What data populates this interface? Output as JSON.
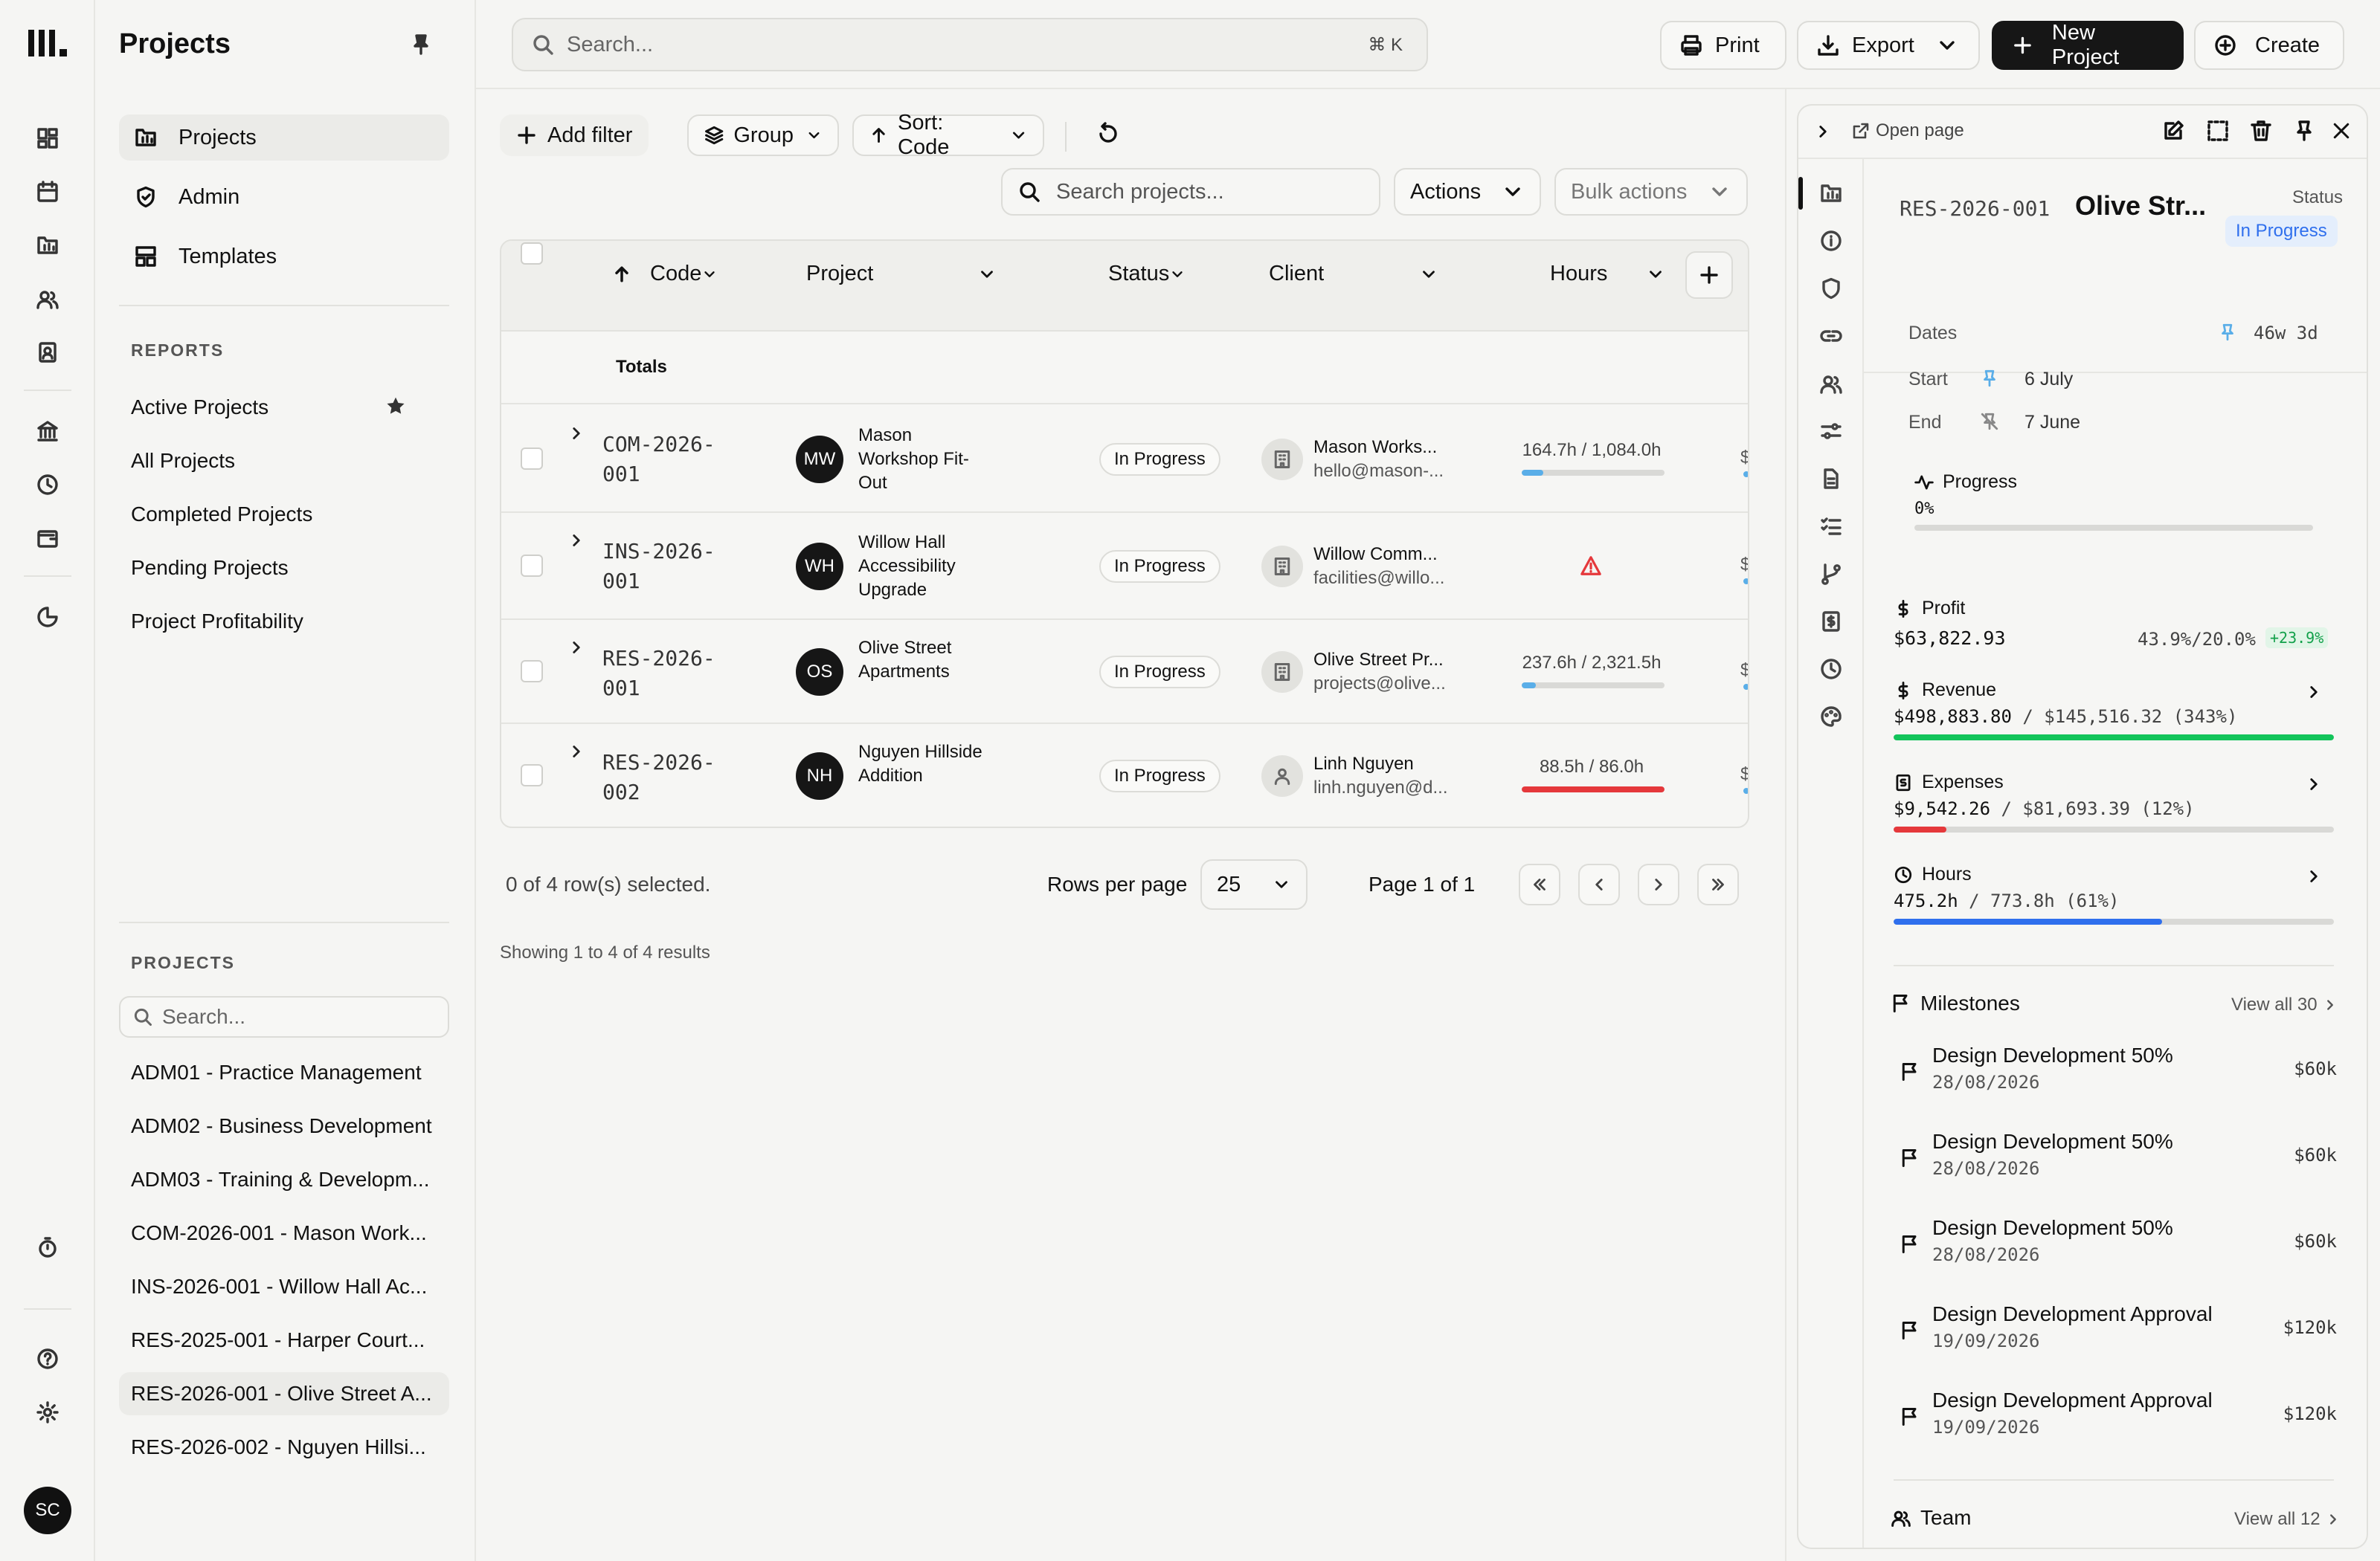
{
  "app": {
    "title": "Projects"
  },
  "sidebar": {
    "title": "Projects",
    "nav": [
      {
        "label": "Projects",
        "icon": "projects-icon"
      },
      {
        "label": "Admin",
        "icon": "shield-icon"
      },
      {
        "label": "Templates",
        "icon": "templates-icon"
      }
    ],
    "reports_label": "REPORTS",
    "reports": [
      "Active Projects",
      "All Projects",
      "Completed Projects",
      "Pending Projects",
      "Project Profitability"
    ],
    "projects_label": "PROJECTS",
    "search_placeholder": "Search...",
    "projects": [
      "ADM01 - Practice Management",
      "ADM02 - Business Development",
      "ADM03 - Training & Developm...",
      "COM-2026-001 - Mason Work...",
      "INS-2026-001 - Willow Hall Ac...",
      "RES-2025-001 - Harper Court...",
      "RES-2026-001 - Olive Street A...",
      "RES-2026-002 - Nguyen Hillsi..."
    ],
    "user_initials": "SC"
  },
  "topbar": {
    "search_placeholder": "Search...",
    "shortcut": "⌘ K",
    "print": "Print",
    "export": "Export",
    "new_project": "New Project",
    "create": "Create"
  },
  "toolbar": {
    "add_filter": "Add filter",
    "group": "Group",
    "sort": "Sort: Code",
    "search_placeholder": "Search projects...",
    "actions": "Actions",
    "bulk_actions": "Bulk actions"
  },
  "table": {
    "columns": [
      "Code",
      "Project",
      "Status",
      "Client",
      "Hours"
    ],
    "totals_label": "Totals",
    "rows": [
      {
        "code1": "COM-2026-",
        "code2": "001",
        "initials": "MW",
        "project": "Mason Workshop Fit-Out",
        "status": "In Progress",
        "client": "Mason Works...",
        "email": "hello@mason-...",
        "hours": "164.7h / 1,084.0h",
        "progress": 0.15,
        "bar_color": "#5aaee8",
        "client_type": "company"
      },
      {
        "code1": "INS-2026-",
        "code2": "001",
        "initials": "WH",
        "project": "Willow Hall Accessibility Upgrade",
        "status": "In Progress",
        "client": "Willow Comm...",
        "email": "facilities@willo...",
        "hours": "",
        "progress": 0,
        "bar_color": "#5aaee8",
        "client_type": "company"
      },
      {
        "code1": "RES-2026-",
        "code2": "001",
        "initials": "OS",
        "project": "Olive Street Apartments",
        "status": "In Progress",
        "client": "Olive Street Pr...",
        "email": "projects@olive...",
        "hours": "237.6h / 2,321.5h",
        "progress": 0.1,
        "bar_color": "#5aaee8",
        "client_type": "company"
      },
      {
        "code1": "RES-2026-",
        "code2": "002",
        "initials": "NH",
        "project": "Nguyen Hillside Addition",
        "status": "In Progress",
        "client": "Linh Nguyen",
        "email": "linh.nguyen@d...",
        "hours": "88.5h / 86.0h",
        "progress": 1.0,
        "bar_color": "#e5383b",
        "client_type": "person"
      }
    ],
    "selected_text": "0 of 4 row(s) selected.",
    "rows_per_page_label": "Rows per page",
    "rows_per_page": "25",
    "page_text": "Page 1 of 1",
    "showing_text": "Showing 1 to 4 of 4 results"
  },
  "panel": {
    "open_page": "Open page",
    "code": "RES-2026-001",
    "name": "Olive Str...",
    "status_label": "Status",
    "status": "In Progress",
    "dates_label": "Dates",
    "duration": "46w 3d",
    "start_label": "Start",
    "start": "6 July",
    "end_label": "End",
    "end": "7 June",
    "progress_label": "Progress",
    "progress_value": "0%",
    "progress": 0,
    "profit_label": "Profit",
    "profit": "$63,822.93",
    "profit_ratio": "43.9%/20.0%",
    "profit_delta": "+23.9%",
    "revenue_label": "Revenue",
    "revenue": "$498,883.80",
    "revenue_rest": " / $145,516.32 (343%)",
    "revenue_progress": 1.0,
    "expenses_label": "Expenses",
    "expenses": "$9,542.26",
    "expenses_rest": " / $81,693.39 (12%)",
    "expenses_progress": 0.12,
    "hours_label": "Hours",
    "hours": "475.2h",
    "hours_rest": " / 773.8h (61%)",
    "hours_progress": 0.61,
    "milestones_label": "Milestones",
    "milestones_view_all": "View all 30",
    "milestones": [
      {
        "title": "Design Development 50%",
        "date": "28/08/2026",
        "amount": "$60k"
      },
      {
        "title": "Design Development 50%",
        "date": "28/08/2026",
        "amount": "$60k"
      },
      {
        "title": "Design Development 50%",
        "date": "28/08/2026",
        "amount": "$60k"
      },
      {
        "title": "Design Development Approval",
        "date": "19/09/2026",
        "amount": "$120k"
      },
      {
        "title": "Design Development Approval",
        "date": "19/09/2026",
        "amount": "$120k"
      }
    ],
    "team_label": "Team",
    "team_view_all": "View all 12"
  },
  "colors": {
    "green": "#12c45a",
    "red": "#e5383b",
    "blue": "#2f6fed",
    "accent_blue": "#5aaee8",
    "status_blue_bg": "#e4eefc",
    "status_blue_text": "#2f6fed"
  }
}
